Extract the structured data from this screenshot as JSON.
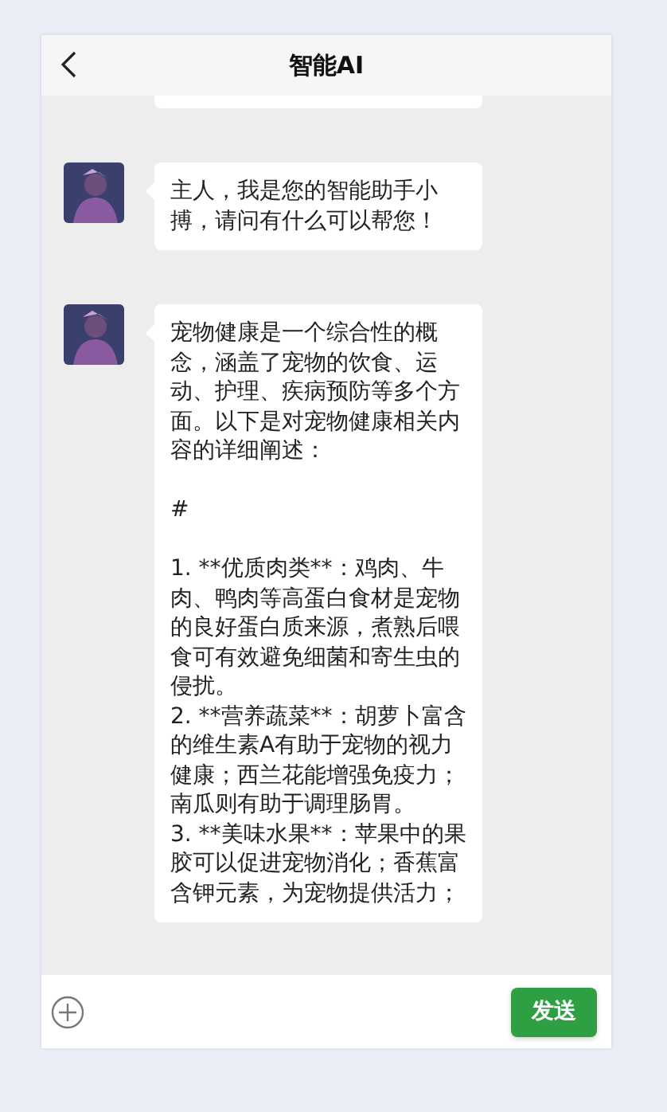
{
  "header": {
    "title": "智能AI"
  },
  "messages": [
    {
      "text": "主人，我是您的智能助手小搏，请问有什么可以帮您！"
    },
    {
      "text": "宠物健康是一个综合性的概念，涵盖了宠物的饮食、运动、护理、疾病预防等多个方面。以下是对宠物健康相关内容的详细阐述：\n\n#\n\n1. **优质肉类**：鸡肉、牛肉、鸭肉等高蛋白食材是宠物的良好蛋白质来源，煮熟后喂食可有效避免细菌和寄生虫的侵扰。\n2. **营养蔬菜**：胡萝卜富含的维生素A有助于宠物的视力健康；西兰花能增强免疫力；南瓜则有助于调理肠胃。\n3. **美味水果**：苹果中的果胶可以促进宠物消化；香蕉富含钾元素，为宠物提供活力；"
    }
  ],
  "input": {
    "send_label": "发送"
  }
}
